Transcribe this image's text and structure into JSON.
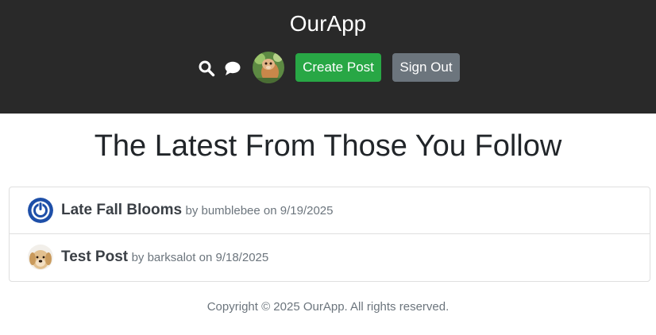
{
  "header": {
    "brand": "OurApp",
    "icons": [
      "search-icon",
      "chat-icon"
    ],
    "create_post_label": "Create Post",
    "sign_out_label": "Sign Out",
    "colors": {
      "background": "#292929",
      "create": "#28a745",
      "signout": "#6c757d"
    }
  },
  "main": {
    "title": "The Latest From Those You Follow",
    "posts": [
      {
        "title": "Late Fall Blooms",
        "by_prefix": "by",
        "author": "bumblebee",
        "on_prefix": "on",
        "date": "9/19/2025",
        "avatar": "power-icon-avatar"
      },
      {
        "title": "Test Post",
        "by_prefix": "by",
        "author": "barksalot",
        "on_prefix": "on",
        "date": "9/18/2025",
        "avatar": "dog-avatar"
      }
    ]
  },
  "footer": {
    "copyright": "Copyright © 2025 OurApp. All rights reserved."
  }
}
